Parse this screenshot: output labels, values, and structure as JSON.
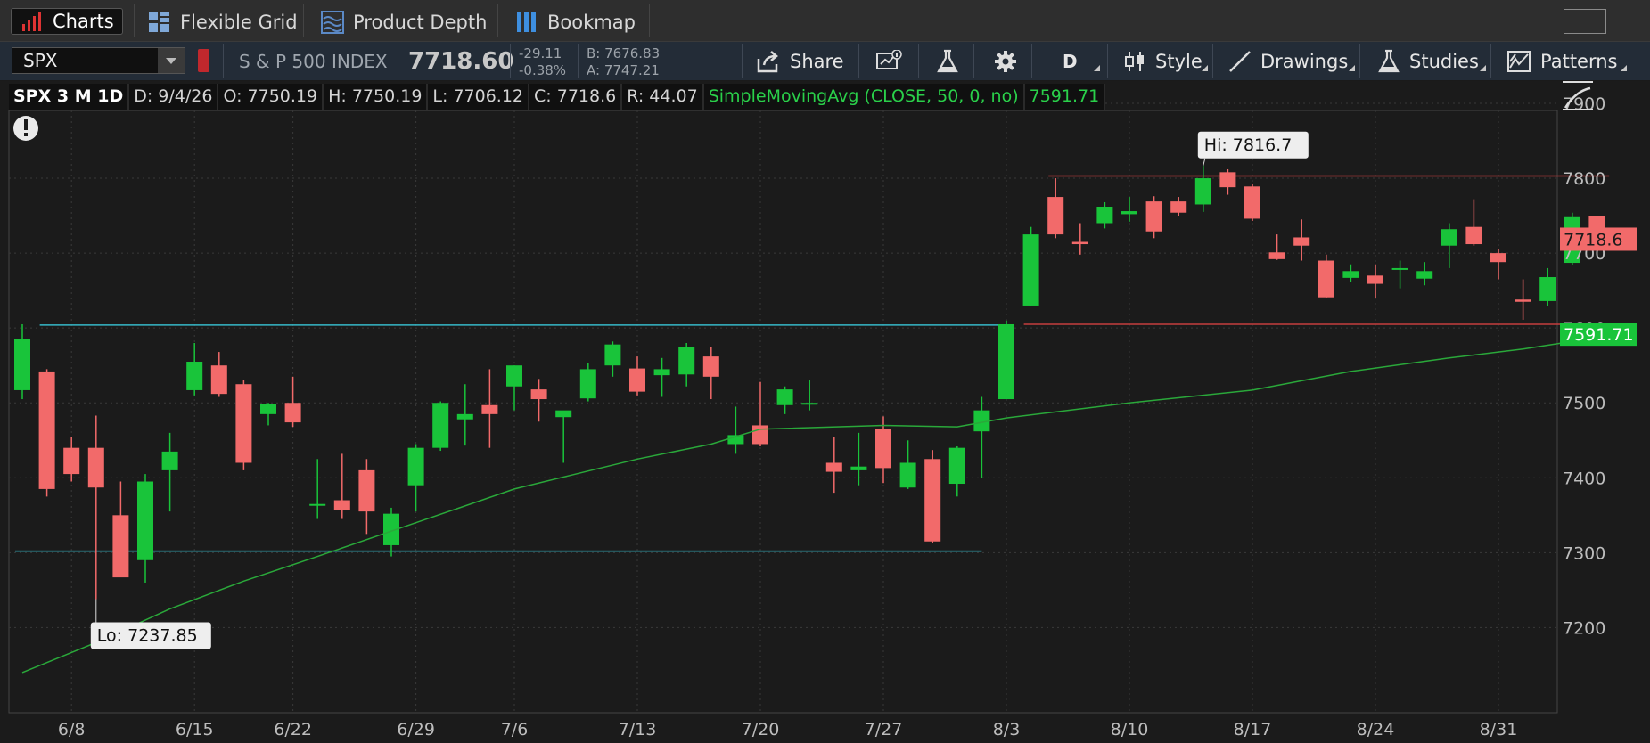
{
  "tabs": [
    {
      "label": "Charts",
      "icon": "bar-chart-icon"
    },
    {
      "label": "Flexible Grid",
      "icon": "grid-icon"
    },
    {
      "label": "Product Depth",
      "icon": "depth-icon"
    },
    {
      "label": "Bookmap",
      "icon": "bookmap-icon"
    }
  ],
  "toolbar": {
    "symbol": "SPX",
    "index_name": "S & P 500 INDEX",
    "last": "7718.60",
    "net_change": "-29.11",
    "pct_change": "-0.38%",
    "bid": "B: 7676.83",
    "ask": "A: 7747.21",
    "share_label": "Share",
    "period_label": "D",
    "style_label": "Style",
    "drawings_label": "Drawings",
    "studies_label": "Studies",
    "patterns_label": "Patterns"
  },
  "infoline": {
    "symbol": "SPX 3 M 1D",
    "date": "D: 9/4/26",
    "open": "O: 7750.19",
    "high": "H: 7750.19",
    "low": "L: 7706.12",
    "close": "C: 7718.6",
    "range": "R: 44.07",
    "study": "SimpleMovingAvg (CLOSE, 50, 0, no)",
    "study_value": "7591.71"
  },
  "colors": {
    "up": "#19c43a",
    "down": "#f26a6a",
    "sma": "#2aa83a",
    "cyan_line": "#36b8c8",
    "red_line": "#c53e3e",
    "last_tag": "#f26a6a",
    "sma_tag": "#19c43a",
    "grid": "#3a3a3a"
  },
  "chart_data": {
    "type": "candlestick",
    "y_axis": {
      "min": 7130,
      "max": 7910,
      "ticks": [
        7200,
        7300,
        7400,
        7500,
        7600,
        7700,
        7800,
        7900
      ]
    },
    "x_ticks": [
      "6/8",
      "6/15",
      "6/22",
      "6/29",
      "7/6",
      "7/13",
      "7/20",
      "7/27",
      "8/3",
      "8/10",
      "8/17",
      "8/24",
      "8/31"
    ],
    "x_tick_index": [
      2,
      7,
      11,
      16,
      20,
      25,
      30,
      35,
      40,
      45,
      50,
      55,
      60
    ],
    "candles": [
      {
        "o": 7517,
        "h": 7605,
        "l": 7505,
        "c": 7585
      },
      {
        "o": 7542,
        "h": 7545,
        "l": 7375,
        "c": 7385
      },
      {
        "o": 7440,
        "h": 7455,
        "l": 7395,
        "c": 7405
      },
      {
        "o": 7440,
        "h": 7483,
        "l": 7238,
        "c": 7387
      },
      {
        "o": 7350,
        "h": 7395,
        "l": 7270,
        "c": 7267
      },
      {
        "o": 7290,
        "h": 7405,
        "l": 7260,
        "c": 7395
      },
      {
        "o": 7410,
        "h": 7460,
        "l": 7355,
        "c": 7435
      },
      {
        "o": 7517,
        "h": 7580,
        "l": 7510,
        "c": 7555
      },
      {
        "o": 7550,
        "h": 7568,
        "l": 7508,
        "c": 7512
      },
      {
        "o": 7525,
        "h": 7530,
        "l": 7410,
        "c": 7420
      },
      {
        "o": 7485,
        "h": 7500,
        "l": 7470,
        "c": 7498
      },
      {
        "o": 7500,
        "h": 7535,
        "l": 7468,
        "c": 7474
      },
      {
        "o": 7365,
        "h": 7425,
        "l": 7345,
        "c": 7365
      },
      {
        "o": 7370,
        "h": 7432,
        "l": 7345,
        "c": 7357
      },
      {
        "o": 7410,
        "h": 7425,
        "l": 7325,
        "c": 7355
      },
      {
        "o": 7310,
        "h": 7360,
        "l": 7295,
        "c": 7352
      },
      {
        "o": 7390,
        "h": 7445,
        "l": 7355,
        "c": 7440
      },
      {
        "o": 7440,
        "h": 7502,
        "l": 7436,
        "c": 7500
      },
      {
        "o": 7478,
        "h": 7525,
        "l": 7443,
        "c": 7485
      },
      {
        "o": 7497,
        "h": 7545,
        "l": 7440,
        "c": 7485
      },
      {
        "o": 7522,
        "h": 7550,
        "l": 7490,
        "c": 7550
      },
      {
        "o": 7518,
        "h": 7532,
        "l": 7475,
        "c": 7505
      },
      {
        "o": 7481,
        "h": 7488,
        "l": 7420,
        "c": 7490
      },
      {
        "o": 7506,
        "h": 7553,
        "l": 7502,
        "c": 7545
      },
      {
        "o": 7550,
        "h": 7582,
        "l": 7535,
        "c": 7578
      },
      {
        "o": 7546,
        "h": 7562,
        "l": 7510,
        "c": 7515
      },
      {
        "o": 7537,
        "h": 7560,
        "l": 7508,
        "c": 7545
      },
      {
        "o": 7538,
        "h": 7580,
        "l": 7522,
        "c": 7575
      },
      {
        "o": 7562,
        "h": 7575,
        "l": 7505,
        "c": 7535
      },
      {
        "o": 7445,
        "h": 7495,
        "l": 7432,
        "c": 7457
      },
      {
        "o": 7470,
        "h": 7528,
        "l": 7442,
        "c": 7445
      },
      {
        "o": 7497,
        "h": 7522,
        "l": 7485,
        "c": 7518
      },
      {
        "o": 7500,
        "h": 7530,
        "l": 7490,
        "c": 7500
      },
      {
        "o": 7420,
        "h": 7455,
        "l": 7380,
        "c": 7408
      },
      {
        "o": 7410,
        "h": 7460,
        "l": 7390,
        "c": 7415
      },
      {
        "o": 7465,
        "h": 7482,
        "l": 7393,
        "c": 7413
      },
      {
        "o": 7387,
        "h": 7450,
        "l": 7385,
        "c": 7420
      },
      {
        "o": 7425,
        "h": 7437,
        "l": 7313,
        "c": 7315
      },
      {
        "o": 7392,
        "h": 7442,
        "l": 7375,
        "c": 7440
      },
      {
        "o": 7462,
        "h": 7508,
        "l": 7400,
        "c": 7490
      },
      {
        "o": 7505,
        "h": 7610,
        "l": 7505,
        "c": 7605
      },
      {
        "o": 7630,
        "h": 7735,
        "l": 7630,
        "c": 7725
      },
      {
        "o": 7775,
        "h": 7800,
        "l": 7720,
        "c": 7725
      },
      {
        "o": 7715,
        "h": 7740,
        "l": 7698,
        "c": 7712
      },
      {
        "o": 7740,
        "h": 7768,
        "l": 7733,
        "c": 7762
      },
      {
        "o": 7752,
        "h": 7775,
        "l": 7742,
        "c": 7756
      },
      {
        "o": 7769,
        "h": 7776,
        "l": 7720,
        "c": 7729
      },
      {
        "o": 7769,
        "h": 7775,
        "l": 7750,
        "c": 7754
      },
      {
        "o": 7765,
        "h": 7817,
        "l": 7755,
        "c": 7800
      },
      {
        "o": 7808,
        "h": 7812,
        "l": 7778,
        "c": 7788
      },
      {
        "o": 7789,
        "h": 7792,
        "l": 7743,
        "c": 7746
      },
      {
        "o": 7701,
        "h": 7725,
        "l": 7691,
        "c": 7692
      },
      {
        "o": 7721,
        "h": 7745,
        "l": 7690,
        "c": 7710
      },
      {
        "o": 7690,
        "h": 7698,
        "l": 7640,
        "c": 7641
      },
      {
        "o": 7667,
        "h": 7685,
        "l": 7662,
        "c": 7676
      },
      {
        "o": 7670,
        "h": 7685,
        "l": 7640,
        "c": 7659
      },
      {
        "o": 7678,
        "h": 7690,
        "l": 7653,
        "c": 7680
      },
      {
        "o": 7666,
        "h": 7688,
        "l": 7657,
        "c": 7676
      },
      {
        "o": 7710,
        "h": 7740,
        "l": 7680,
        "c": 7732
      },
      {
        "o": 7735,
        "h": 7772,
        "l": 7710,
        "c": 7712
      },
      {
        "o": 7700,
        "h": 7705,
        "l": 7665,
        "c": 7688
      },
      {
        "o": 7638,
        "h": 7665,
        "l": 7611,
        "c": 7635
      },
      {
        "o": 7636,
        "h": 7680,
        "l": 7630,
        "c": 7668
      },
      {
        "o": 7687,
        "h": 7754,
        "l": 7684,
        "c": 7748
      },
      {
        "o": 7750,
        "h": 7750,
        "l": 7706,
        "c": 7718.6
      }
    ],
    "sma_50": [
      {
        "i": 0,
        "v": 7140
      },
      {
        "i": 3,
        "v": 7180
      },
      {
        "i": 6,
        "v": 7225
      },
      {
        "i": 9,
        "v": 7262
      },
      {
        "i": 12,
        "v": 7295
      },
      {
        "i": 16,
        "v": 7340
      },
      {
        "i": 20,
        "v": 7385
      },
      {
        "i": 25,
        "v": 7425
      },
      {
        "i": 28,
        "v": 7445
      },
      {
        "i": 30,
        "v": 7465
      },
      {
        "i": 35,
        "v": 7470
      },
      {
        "i": 38,
        "v": 7468
      },
      {
        "i": 40,
        "v": 7480
      },
      {
        "i": 45,
        "v": 7500
      },
      {
        "i": 50,
        "v": 7517
      },
      {
        "i": 54,
        "v": 7542
      },
      {
        "i": 58,
        "v": 7560
      },
      {
        "i": 61,
        "v": 7572
      },
      {
        "i": 63,
        "v": 7582
      },
      {
        "i": 64,
        "v": 7591.71
      }
    ],
    "lines": [
      {
        "kind": "horizontal",
        "y": 7604,
        "from": 1,
        "to": 40,
        "color": "cyan"
      },
      {
        "kind": "horizontal",
        "y": 7302,
        "from": 0,
        "to": 39,
        "color": "cyan"
      },
      {
        "kind": "horizontal",
        "y": 7803,
        "from": 42,
        "to": 64.5,
        "color": "red"
      },
      {
        "kind": "horizontal",
        "y": 7605,
        "from": 41,
        "to": 64.5,
        "color": "red"
      }
    ],
    "hi_label": "Hi: 7816.7",
    "lo_label": "Lo: 7237.85",
    "hi_index": 48,
    "lo_index": 3,
    "last_tag": "7718.6",
    "sma_tag": "7591.71"
  }
}
